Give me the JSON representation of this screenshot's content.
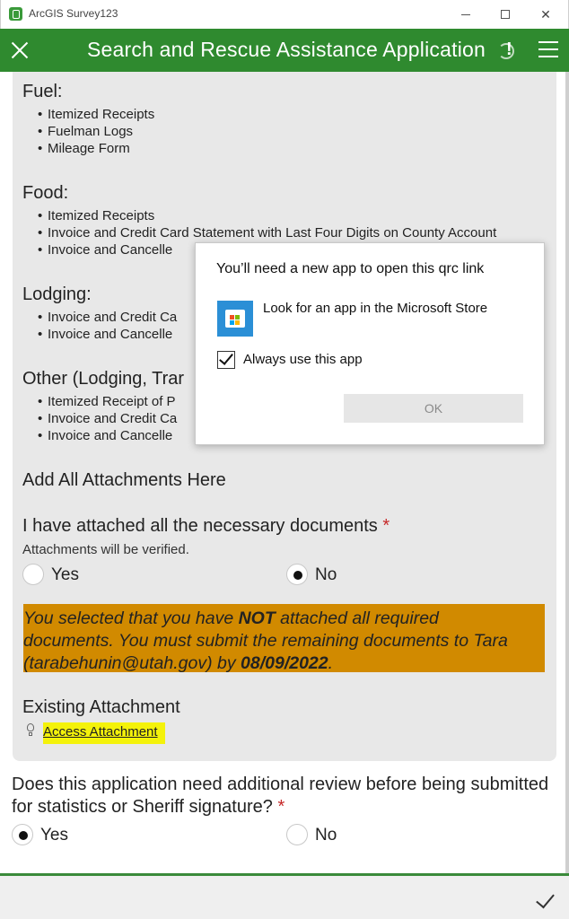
{
  "window": {
    "title": "ArcGIS Survey123"
  },
  "header": {
    "title": "Search and Rescue Assistance Application"
  },
  "sections": [
    {
      "title": "Fuel:",
      "items": [
        "Itemized Receipts",
        "Fuelman Logs",
        "Mileage Form"
      ]
    },
    {
      "title": "Food:",
      "items": [
        "Itemized Receipts",
        "Invoice and Credit Card Statement with Last Four Digits on County Account",
        "Invoice and Cancelle"
      ]
    },
    {
      "title": "Lodging:",
      "items": [
        "Invoice and Credit Ca",
        "Invoice and Cancelle"
      ]
    },
    {
      "title": "Other (Lodging, Trar",
      "items": [
        "Itemized Receipt of P",
        "Invoice and Credit Ca",
        "Invoice and Cancelle"
      ]
    }
  ],
  "attachments_heading": "Add All Attachments Here",
  "question1": {
    "label": "I have attached all the necessary documents",
    "required": "*",
    "hint": "Attachments will be verified.",
    "options": [
      "Yes",
      "No"
    ],
    "selected": "No"
  },
  "note": {
    "line1_a": "You selected that you have ",
    "line1_b": "NOT",
    "line1_c": " attached all required",
    "line2": "documents. You must submit the remaining documents to Tara",
    "line3_a": "(tarabehunin@utah.gov) by ",
    "line3_b": "08/09/2022",
    "line3_c": ".",
    "bg_color": "#d18a00"
  },
  "existing_attachment": {
    "title": "Existing Attachment",
    "link": "Access Attachment",
    "icon": "lightbulb-icon"
  },
  "question2": {
    "label": "Does this application need additional review before being submitted for statistics or Sheriff signature?",
    "required": "*",
    "options": [
      "Yes",
      "No"
    ],
    "selected": "Yes"
  },
  "dialog": {
    "title": "You’ll need a new app to open this qrc link",
    "store_option": "Look for an app in the Microsoft Store",
    "checkbox_label": "Always use this app",
    "checkbox_checked": true,
    "ok_label": "OK"
  },
  "colors": {
    "header": "#2f8a2f",
    "accent": "#3a8a3a",
    "highlight": "#f4f20a"
  }
}
